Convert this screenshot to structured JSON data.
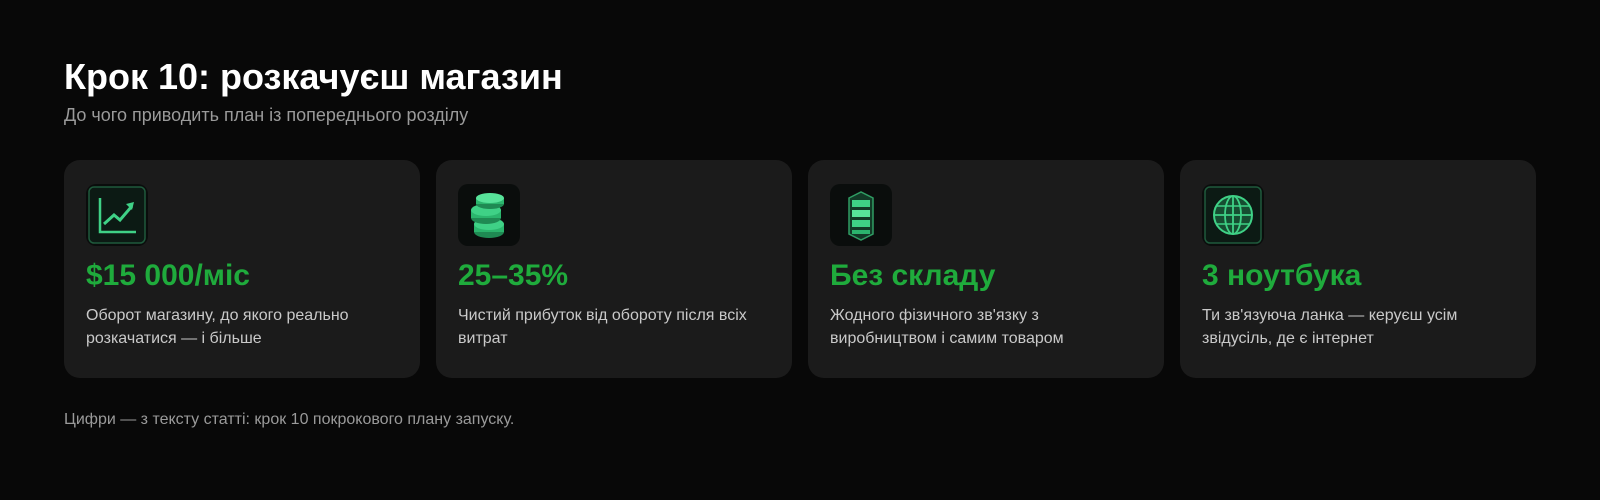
{
  "header": {
    "title": "Крок 10: розкачуєш магазин",
    "subtitle": "До чого приводить план із попереднього розділу"
  },
  "cards": [
    {
      "icon": "growth-chart-icon",
      "value": "$15 000/міс",
      "description": "Оборот магазину, до якого реально розкачатися — і більше"
    },
    {
      "icon": "coin-stack-icon",
      "value": "25–35%",
      "description": "Чистий прибуток від обороту після всіх витрат"
    },
    {
      "icon": "server-stack-icon",
      "value": "Без складу",
      "description": "Жодного фізичного зв'язку з виробництвом і самим товаром"
    },
    {
      "icon": "globe-icon",
      "value": "3 ноутбука",
      "description": "Ти зв'язуюча ланка — керуєш усім звідусіль, де є інтернет"
    }
  ],
  "footnote": "Цифри — з тексту статті: крок 10 покрокового плану запуску.",
  "colors": {
    "background": "#080808",
    "card": "#1b1b1b",
    "accent": "#1fab3c",
    "muted": "#9a9a9a"
  }
}
